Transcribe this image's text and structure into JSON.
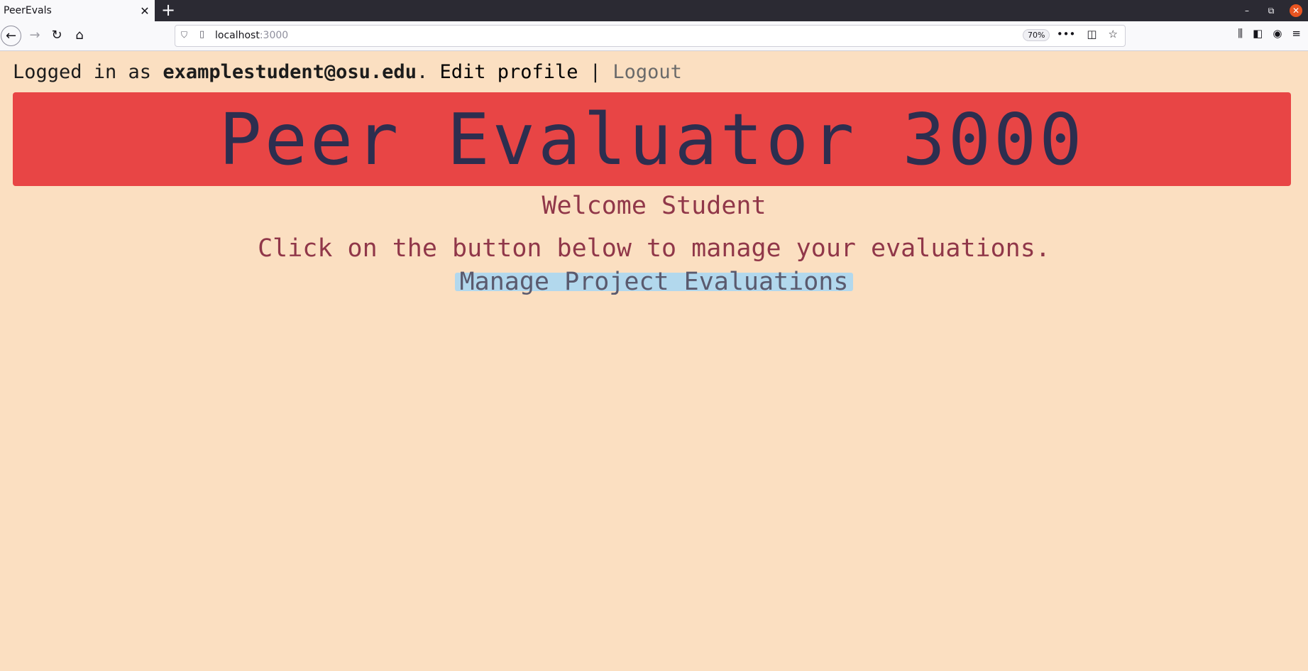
{
  "browser": {
    "tab_title": "PeerEvals",
    "tab_close": "✕",
    "new_tab": "+",
    "url_host": "localhost",
    "url_port": ":3000",
    "zoom": "70%",
    "window_controls": {
      "minimize": "–",
      "restore": "⧉",
      "close": "✕"
    }
  },
  "header": {
    "logged_in_prefix": "Logged in as ",
    "email": "examplestudent@osu.edu",
    "separator_dot": ". ",
    "edit_profile": "Edit profile",
    "pipe": " | ",
    "logout": "Logout"
  },
  "banner": {
    "title": "Peer Evaluator 3000"
  },
  "main": {
    "welcome": "Welcome Student",
    "instructions": "Click on the button below to manage your evaluations.",
    "manage_button": "Manage Project Evaluations"
  },
  "colors": {
    "page_background": "#fbdfc1",
    "banner_background": "#e84545",
    "banner_text": "#2d2e4f",
    "accent_text": "#903749",
    "button_background": "#b2d8ed"
  }
}
